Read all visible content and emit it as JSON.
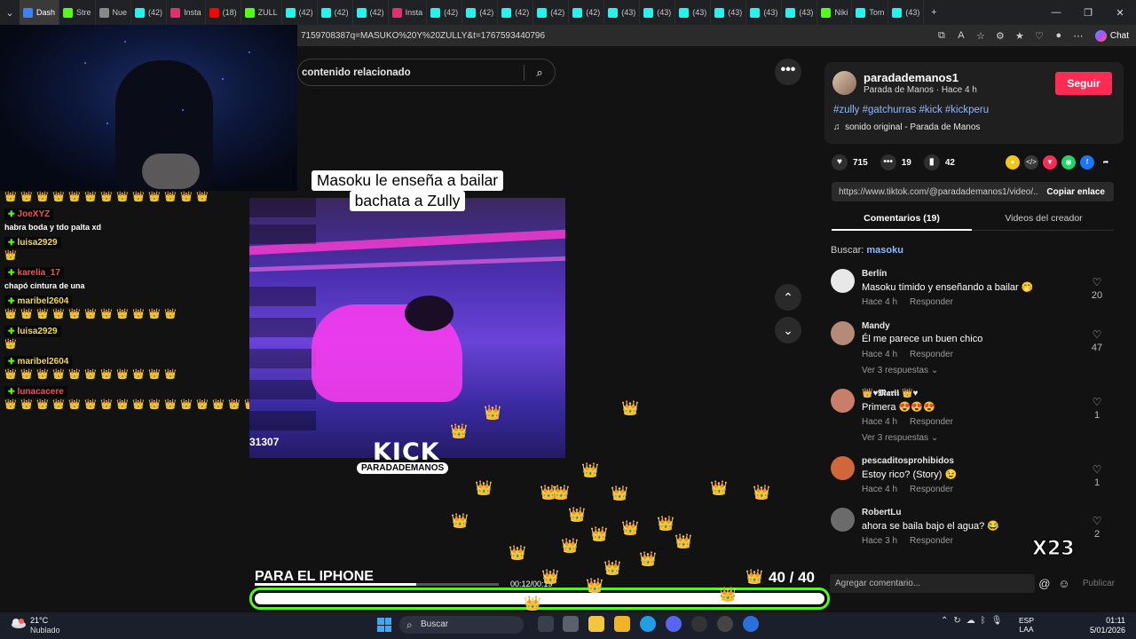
{
  "browser": {
    "tabs": [
      {
        "label": "Dash",
        "color": "#3b82f6",
        "active": true
      },
      {
        "label": "Stre",
        "color": "#53fc18"
      },
      {
        "label": "Nue",
        "color": "#888888"
      },
      {
        "label": "(42)",
        "color": "#25f4ee"
      },
      {
        "label": "Insta",
        "color": "#e1306c"
      },
      {
        "label": "(18)",
        "color": "#ff0000"
      },
      {
        "label": "ZULL",
        "color": "#53fc18"
      },
      {
        "label": "(42)",
        "color": "#25f4ee"
      },
      {
        "label": "(42)",
        "color": "#25f4ee"
      },
      {
        "label": "(42)",
        "color": "#25f4ee"
      },
      {
        "label": "Insta",
        "color": "#e1306c"
      },
      {
        "label": "(42)",
        "color": "#25f4ee"
      },
      {
        "label": "(42)",
        "color": "#25f4ee"
      },
      {
        "label": "(42)",
        "color": "#25f4ee"
      },
      {
        "label": "(42)",
        "color": "#25f4ee"
      },
      {
        "label": "(42)",
        "color": "#25f4ee"
      },
      {
        "label": "(43)",
        "color": "#25f4ee"
      },
      {
        "label": "(43)",
        "color": "#25f4ee"
      },
      {
        "label": "(43)",
        "color": "#25f4ee"
      },
      {
        "label": "(43)",
        "color": "#25f4ee"
      },
      {
        "label": "(43)",
        "color": "#25f4ee"
      },
      {
        "label": "(43)",
        "color": "#25f4ee"
      },
      {
        "label": "Niki",
        "color": "#53fc18"
      },
      {
        "label": "Tom",
        "color": "#25f4ee"
      },
      {
        "label": "(43)",
        "color": "#25f4ee"
      }
    ],
    "url": "7159708387q=MASUKO%20Y%20ZULLY&t=1767593440796",
    "chat_label": "Chat",
    "minimize": "—",
    "maximize": "❐",
    "close": "✕"
  },
  "stream_chat": {
    "messages": [
      {
        "user": "JoeXYZ",
        "color": "#ff4d4d",
        "text": "habra boda y tdo palta xd",
        "emotes": 0
      },
      {
        "user": "luisa2929",
        "color": "#f5d94b",
        "text": "",
        "emotes": 1
      },
      {
        "user": "karelia_17",
        "color": "#ff4d4d",
        "text": "chapó cintura de una",
        "emotes": 0
      },
      {
        "user": "maribel2604",
        "color": "#f5d94b",
        "text": "",
        "emotes": 11
      },
      {
        "user": "luisa2929",
        "color": "#f5d94b",
        "text": "",
        "emotes": 1
      },
      {
        "user": "maribel2604",
        "color": "#f5d94b",
        "text": "",
        "emotes": 11
      },
      {
        "user": "lunacacere",
        "color": "#ff4d4d",
        "text": "",
        "emotes": 16
      }
    ]
  },
  "video": {
    "related_placeholder": "contenido relacionado",
    "caption_line1": "Masoku le enseña a bailar",
    "caption_line2": "bachata a Zully",
    "viewer_count": "31307",
    "kick_logo": "KICK",
    "kick_handle": "PARADADEMANOS",
    "bottom_text": "PARA EL IPHONE",
    "time": "00:12/00:19",
    "progress_fraction": 0.66,
    "goal_count": "40 / 40",
    "combo": "X23"
  },
  "post": {
    "author": "paradademanos1",
    "author_sub": "Parada de Manos · Hace 4 h",
    "follow_label": "Seguir",
    "hashtags": "#zully #gatchurras #kick #kickperu",
    "sound": "sonido original - Parada de Manos",
    "likes": "715",
    "comments_count": "19",
    "saves": "42",
    "link": "https://www.tiktok.com/@paradademanos1/video/...",
    "copy_label": "Copiar enlace",
    "tab_comments": "Comentarios (19)",
    "tab_creator": "Videos del creador",
    "search_label": "Buscar:",
    "search_term": "masoku",
    "add_comment_placeholder": "Agregar comentario...",
    "publish_label": "Publicar"
  },
  "comments": [
    {
      "user": "Berlín",
      "text": "Masoku tímido y enseñando a bailar 🤭",
      "time": "Hace 4 h",
      "reply": "Responder",
      "likes": "20",
      "replies": "",
      "avatar": "#e8e8e8"
    },
    {
      "user": "Mandy",
      "text": "Él me parece un buen chico",
      "time": "Hace 4 h",
      "reply": "Responder",
      "likes": "47",
      "replies": "Ver 3 respuestas ⌄",
      "avatar": "#b58a78"
    },
    {
      "user": "👑♥𝕸𝖆𝖗𝖎𝖎 👑♥",
      "text": "Primera 😍😍😍",
      "time": "Hace 4 h",
      "reply": "Responder",
      "likes": "1",
      "replies": "Ver 3 respuestas ⌄",
      "avatar": "#c97d6b"
    },
    {
      "user": "pescaditosprohibidos",
      "text": "Estoy rico? (Story) 😉",
      "time": "Hace 4 h",
      "reply": "Responder",
      "likes": "1",
      "replies": "",
      "avatar": "#d0663a"
    },
    {
      "user": "RobertLu",
      "text": "ahora se baila bajo el agua? 😂",
      "time": "Hace 3 h",
      "reply": "Responder",
      "likes": "2",
      "replies": "",
      "avatar": "#6b6b6b"
    }
  ],
  "taskbar": {
    "temp": "21°C",
    "weather": "Nublado",
    "search": "Buscar",
    "lang_line1": "ESP",
    "lang_line2": "LAA",
    "time": "01:11",
    "date": "5/01/2026"
  }
}
